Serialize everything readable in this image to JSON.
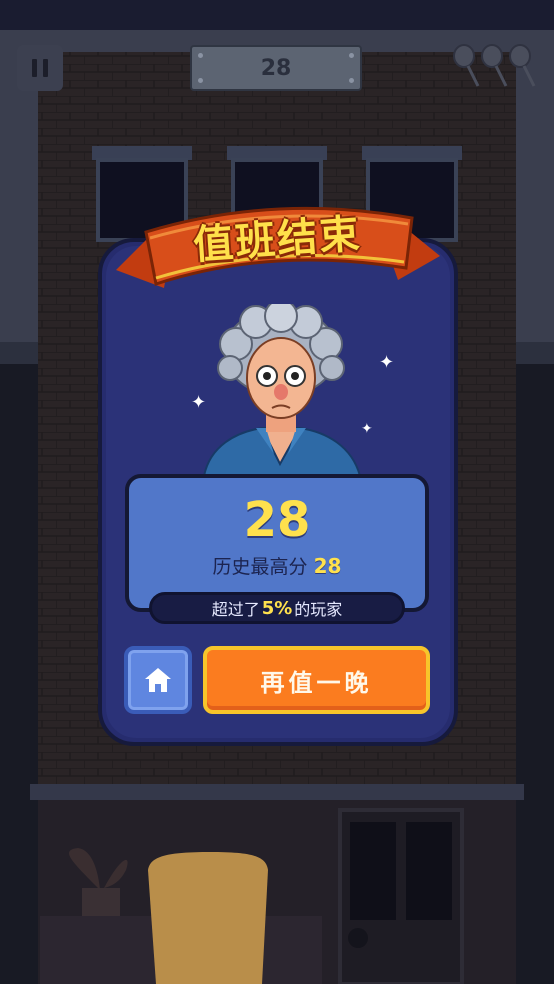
{
  "hud": {
    "score": "28",
    "lives_remaining": 3
  },
  "result": {
    "title": "值班结束",
    "score": "28",
    "best_label": "历史最高分",
    "best_score": "28",
    "rank_prefix": "超过了",
    "rank_percent": "5%",
    "rank_suffix": "的玩家"
  },
  "buttons": {
    "replay_label": "再值一晚"
  },
  "colors": {
    "accent": "#ffe14d",
    "replay_button": "#fb7c1f",
    "home_button": "#5f86e0",
    "card": "#2b3278",
    "banner": "#d4481a"
  },
  "icons": {
    "pause": "pause-icon",
    "home": "home-icon",
    "lives": "balloon-icon"
  }
}
